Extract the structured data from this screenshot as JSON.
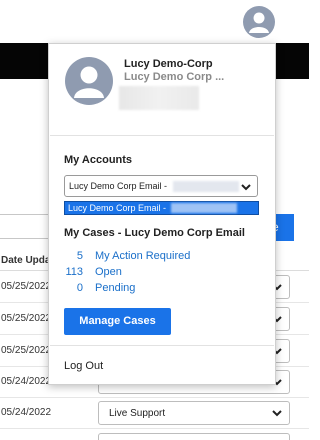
{
  "header": {
    "user_icon": "user-avatar-icon"
  },
  "background_table": {
    "column_header": "Date Updated",
    "rows": [
      {
        "date": "05/25/2022",
        "status": ""
      },
      {
        "date": "05/25/2022",
        "status": ""
      },
      {
        "date": "05/25/2022",
        "status": ""
      },
      {
        "date": "05/24/2022",
        "status": ""
      },
      {
        "date": "05/24/2022",
        "status": "Live Support"
      }
    ]
  },
  "profile": {
    "name": "Lucy Demo-Corp",
    "org": "Lucy Demo Corp ...",
    "avatar_icon": "user-avatar-icon"
  },
  "accounts": {
    "title": "My Accounts",
    "selected": "Lucy Demo Corp Email -",
    "options": [
      "Lucy Demo Corp Email -"
    ]
  },
  "cases": {
    "title": "My Cases - Lucy Demo Corp Email",
    "items": [
      {
        "count": "5",
        "label": "My Action Required"
      },
      {
        "count": "113",
        "label": "Open"
      },
      {
        "count": "0",
        "label": "Pending"
      }
    ],
    "manage_label": "Manage Cases"
  },
  "logout_label": "Log Out",
  "colors": {
    "accent": "#1a73e8",
    "link": "#1a6fc9",
    "avatar": "#8f9bb0"
  }
}
